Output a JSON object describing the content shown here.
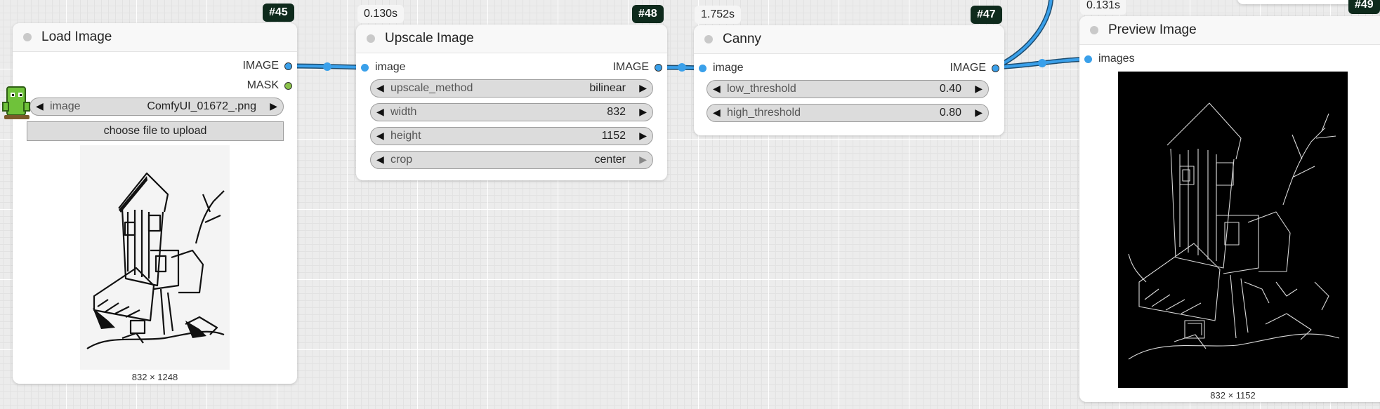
{
  "nodes": {
    "load_image": {
      "id": "#45",
      "title": "Load Image",
      "outputs": [
        "IMAGE",
        "MASK"
      ],
      "widget": {
        "name": "image",
        "value": "ComfyUI_01672_.png"
      },
      "upload_button": "choose file to upload",
      "preview_dims": "832 × 1248"
    },
    "upscale_image": {
      "id": "#48",
      "timing": "0.130s",
      "title": "Upscale Image",
      "input": "image",
      "output": "IMAGE",
      "widgets": [
        {
          "name": "upscale_method",
          "value": "bilinear"
        },
        {
          "name": "width",
          "value": "832"
        },
        {
          "name": "height",
          "value": "1152"
        },
        {
          "name": "crop",
          "value": "center"
        }
      ]
    },
    "canny": {
      "id": "#47",
      "timing": "1.752s",
      "title": "Canny",
      "input": "image",
      "output": "IMAGE",
      "widgets": [
        {
          "name": "low_threshold",
          "value": "0.40"
        },
        {
          "name": "high_threshold",
          "value": "0.80"
        }
      ]
    },
    "preview_image": {
      "id": "#49",
      "timing": "0.131s",
      "title": "Preview Image",
      "input": "images",
      "preview_dims": "832 × 1152"
    }
  },
  "colors": {
    "image_port": "#3aa0ea",
    "mask_port": "#8bc34a",
    "badge_bg": "#0e2a1c",
    "wire": "#3aa0ea"
  }
}
